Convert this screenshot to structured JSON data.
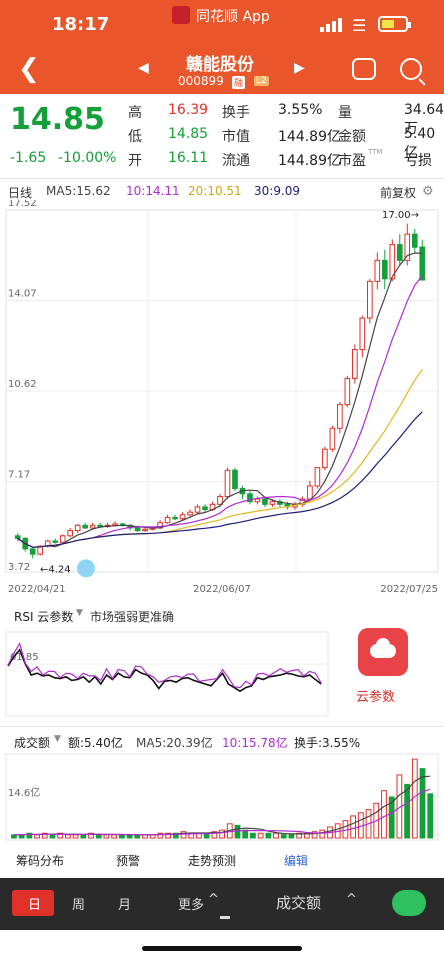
{
  "status_bar": {
    "time": "18:17",
    "app_name": "同花顺 App"
  },
  "nav": {
    "stock_name": "赣能股份",
    "stock_code": "000899",
    "market_tag": "融",
    "level_tag": "L2"
  },
  "quote": {
    "price": "14.85",
    "change": "-1.65",
    "change_pct": "-10.00%",
    "fields": [
      {
        "label": "高",
        "value": "16.39",
        "tone": "red"
      },
      {
        "label": "换手",
        "value": "3.55%",
        "tone": "blk"
      },
      {
        "label": "量",
        "value": "34.64万",
        "tone": "blk"
      },
      {
        "label": "低",
        "value": "14.85",
        "tone": "grn"
      },
      {
        "label": "市值",
        "value": "144.89亿",
        "tone": "blk"
      },
      {
        "label": "金额",
        "value": "5.40亿",
        "tone": "blk"
      },
      {
        "label": "开",
        "value": "16.11",
        "tone": "grn"
      },
      {
        "label": "流通",
        "value": "144.89亿",
        "tone": "blk"
      },
      {
        "label": "市盈",
        "label_sup": "TTM",
        "value": "亏损",
        "tone": "blk"
      }
    ]
  },
  "ma_legend": {
    "period": "日线",
    "ma5": "MA5:15.62",
    "ma10": "10:14.11",
    "ma20": "20:10.51",
    "ma30": "30:9.09",
    "adjust": "前复权"
  },
  "kline": {
    "y_labels": [
      "17.52",
      "14.07",
      "10.62",
      "7.17",
      "3.72"
    ],
    "x_labels": [
      "2022/04/21",
      "2022/06/07",
      "2022/07/25"
    ],
    "high_mark": "17.00→",
    "low_mark": "←4.24",
    "colors": {
      "up": "#e0302a",
      "down": "#14a038",
      "ma5": "#444444",
      "ma10": "#b02bd0",
      "ma20": "#e6b71d",
      "ma30": "#1d1d7a"
    }
  },
  "chart_data": {
    "type": "candlestick",
    "y_range": [
      3.72,
      17.52
    ],
    "x_start": "2022/04/21",
    "x_mid": "2022/06/07",
    "x_end": "2022/07/25",
    "candles": [
      [
        5.1,
        5.0,
        5.2,
        4.9
      ],
      [
        5.0,
        4.6,
        5.05,
        4.5
      ],
      [
        4.6,
        4.4,
        4.65,
        4.24
      ],
      [
        4.4,
        4.7,
        4.75,
        4.35
      ],
      [
        4.7,
        4.9,
        4.95,
        4.65
      ],
      [
        4.9,
        4.85,
        5.0,
        4.8
      ],
      [
        4.85,
        5.1,
        5.15,
        4.8
      ],
      [
        5.1,
        5.3,
        5.4,
        5.05
      ],
      [
        5.3,
        5.5,
        5.55,
        5.2
      ],
      [
        5.5,
        5.4,
        5.6,
        5.35
      ],
      [
        5.4,
        5.5,
        5.6,
        5.35
      ],
      [
        5.5,
        5.45,
        5.6,
        5.4
      ],
      [
        5.45,
        5.5,
        5.6,
        5.4
      ],
      [
        5.5,
        5.55,
        5.65,
        5.45
      ],
      [
        5.55,
        5.5,
        5.6,
        5.45
      ],
      [
        5.5,
        5.4,
        5.55,
        5.3
      ],
      [
        5.4,
        5.3,
        5.45,
        5.25
      ],
      [
        5.3,
        5.35,
        5.4,
        5.25
      ],
      [
        5.35,
        5.4,
        5.45,
        5.3
      ],
      [
        5.4,
        5.6,
        5.7,
        5.35
      ],
      [
        5.6,
        5.8,
        5.9,
        5.55
      ],
      [
        5.8,
        5.75,
        5.9,
        5.7
      ],
      [
        5.75,
        5.9,
        6.0,
        5.7
      ],
      [
        5.9,
        6.0,
        6.1,
        5.85
      ],
      [
        6.0,
        6.2,
        6.3,
        5.95
      ],
      [
        6.2,
        6.1,
        6.3,
        6.0
      ],
      [
        6.1,
        6.3,
        6.4,
        6.05
      ],
      [
        6.3,
        6.6,
        6.7,
        6.2
      ],
      [
        6.6,
        7.6,
        7.7,
        6.5
      ],
      [
        7.6,
        6.9,
        7.7,
        6.8
      ],
      [
        6.9,
        6.7,
        7.0,
        6.5
      ],
      [
        6.7,
        6.4,
        6.8,
        6.3
      ],
      [
        6.4,
        6.5,
        6.6,
        6.3
      ],
      [
        6.5,
        6.3,
        6.6,
        6.2
      ],
      [
        6.3,
        6.4,
        6.5,
        6.2
      ],
      [
        6.4,
        6.3,
        6.5,
        6.2
      ],
      [
        6.3,
        6.2,
        6.4,
        6.1
      ],
      [
        6.2,
        6.3,
        6.4,
        6.1
      ],
      [
        6.3,
        6.5,
        6.6,
        6.2
      ],
      [
        6.5,
        7.0,
        7.2,
        6.4
      ],
      [
        7.0,
        7.7,
        7.7,
        6.9
      ],
      [
        7.7,
        8.4,
        8.5,
        7.6
      ],
      [
        8.4,
        9.2,
        9.3,
        8.3
      ],
      [
        9.2,
        10.1,
        10.2,
        9.0
      ],
      [
        10.1,
        11.1,
        11.2,
        10.0
      ],
      [
        11.1,
        12.2,
        12.4,
        10.9
      ],
      [
        12.2,
        13.4,
        13.5,
        11.9
      ],
      [
        13.4,
        14.8,
        14.9,
        13.2
      ],
      [
        14.8,
        15.6,
        15.9,
        14.5
      ],
      [
        15.6,
        14.9,
        16.0,
        14.5
      ],
      [
        14.9,
        16.2,
        16.4,
        14.8
      ],
      [
        16.2,
        15.6,
        16.6,
        15.4
      ],
      [
        15.6,
        16.6,
        17.0,
        15.4
      ],
      [
        16.6,
        16.1,
        16.8,
        15.9
      ],
      [
        16.11,
        14.85,
        16.39,
        14.85
      ]
    ],
    "candle_fields": [
      "open",
      "close",
      "high",
      "low"
    ]
  },
  "rsi": {
    "title": "RSI 云参数",
    "desc": "市场强弱更准确",
    "level": "61.85",
    "cloud_label": "云参数"
  },
  "volume": {
    "title": "成交额",
    "amount": "额:5.40亿",
    "ma5": "MA5:20.39亿",
    "ma10": "10:15.78亿",
    "turnover": "换手:3.55%",
    "y_label": "14.6亿"
  },
  "tabs": [
    "筹码分布",
    "预警",
    "走势预测",
    "编辑"
  ],
  "bottom": {
    "periods": [
      "日",
      "周",
      "月"
    ],
    "more": "更多",
    "indicator": "成交额"
  }
}
